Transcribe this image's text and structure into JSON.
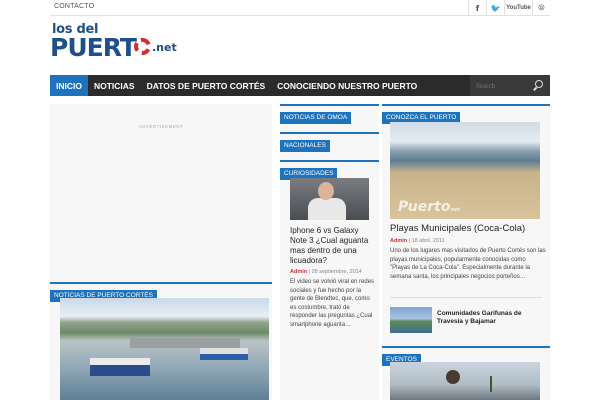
{
  "topbar": {
    "contact_label": "CONTACTO",
    "social": {
      "facebook": "f",
      "twitter": "🐦",
      "youtube": "YouTube",
      "rss": "⦾"
    }
  },
  "logo": {
    "line1": "los del",
    "line2": "PUERT",
    "suffix": ".net"
  },
  "nav": {
    "items": [
      {
        "label": "INICIO",
        "active": true
      },
      {
        "label": "NOTICIAS"
      },
      {
        "label": "DATOS DE PUERTO CORTÉS"
      },
      {
        "label": "CONOCIENDO NUESTRO PUERTO"
      }
    ],
    "search_placeholder": "Search"
  },
  "col1": {
    "ad_label": "ADVERTISEMENT",
    "section_label": "NOTICIAS DE PUERTO CORTÉS"
  },
  "col2": {
    "sections": [
      "NOTICIAS DE OMOA",
      "NACIONALES",
      "CURIOSIDADES"
    ],
    "article": {
      "title": "Iphone 6 vs Galaxy Note 3 ¿Cual aguanta mas dentro de una licuadora?",
      "author": "Admin",
      "date": "28 septiembre, 2014",
      "excerpt": "El video se volvió viral en redes sociales y fue hecho por la gente de Blendtec, que, como es costumbre, trató de responder las preguntas ¿Cual smartphone aguanta…"
    }
  },
  "col3": {
    "section_label": "CONOZCA EL PUERTO",
    "article": {
      "title": "Playas Municipales (Coca-Cola)",
      "author": "Admin",
      "date": "18 abril, 2011",
      "excerpt": "Uno de los lugares mas visitados de Puerto Cortés son las playas municipales, popularmente conocidas como \"Playas de La Coca-Cola\". Especialmente durante la semana santa, los principales negocios porteños…"
    },
    "watermark": "Puerto",
    "watermark_small": "net",
    "small_article": {
      "title": "Comunidades Garifunas de Travesia y Bajamar"
    },
    "events_label": "EVENTOS"
  }
}
